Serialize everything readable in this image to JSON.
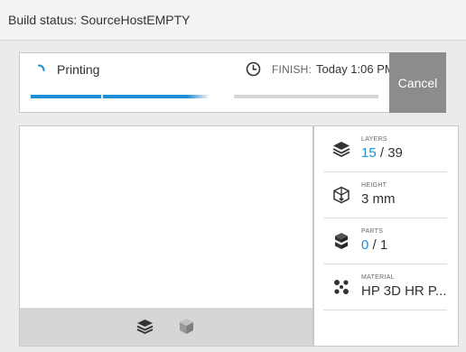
{
  "window": {
    "title": "Build status: SourceHostEMPTY"
  },
  "status": {
    "state": "Printing",
    "finish_label": "FINISH:",
    "finish_time": "Today 1:06 PM",
    "cancel_label": "Cancel",
    "progress_fraction": 0.38
  },
  "info": {
    "layers": {
      "label": "LAYERS",
      "current": "15",
      "separator": " / ",
      "total": "39"
    },
    "height": {
      "label": "HEIGHT",
      "value": "3 mm"
    },
    "parts": {
      "label": "PARTS",
      "current": "0",
      "separator": " / ",
      "total": "1"
    },
    "material": {
      "label": "MATERIAL",
      "value": "HP 3D HR P..."
    }
  },
  "colors": {
    "accent": "#1d8dd4",
    "cancel_bg": "#8c8c8c",
    "panel_bg": "#ebebeb"
  },
  "icons": [
    "spinner-icon",
    "clock-icon",
    "layers-icon",
    "cube-icon",
    "height-icon",
    "parts-icon",
    "material-icon"
  ]
}
